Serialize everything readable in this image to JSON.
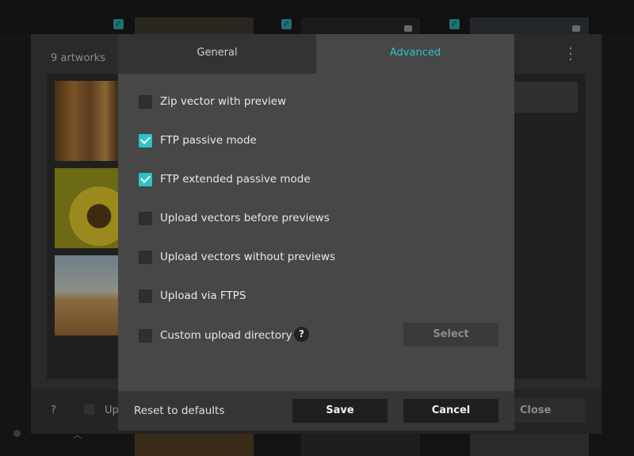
{
  "background": {
    "panel_title": "9 artworks",
    "menu_icon": "vertical-ellipsis-icon",
    "help_text": "?",
    "upload_label_partial": "Up",
    "close_label": "Close"
  },
  "dialog": {
    "tabs": [
      {
        "label": "General",
        "active": false
      },
      {
        "label": "Advanced",
        "active": true
      }
    ],
    "accent_color": "#2bc3c8",
    "options": [
      {
        "label": "Zip vector with preview",
        "checked": false
      },
      {
        "label": "FTP passive mode",
        "checked": true
      },
      {
        "label": "FTP extended passive mode",
        "checked": true
      },
      {
        "label": "Upload vectors before previews",
        "checked": false
      },
      {
        "label": "Upload vectors without previews",
        "checked": false
      },
      {
        "label": "Upload via FTPS",
        "checked": false
      },
      {
        "label": "Custom upload directory",
        "checked": false
      }
    ],
    "custom_dir_help": "?",
    "select_label": "Select",
    "footer": {
      "reset_label": "Reset to defaults",
      "save_label": "Save",
      "cancel_label": "Cancel"
    }
  }
}
